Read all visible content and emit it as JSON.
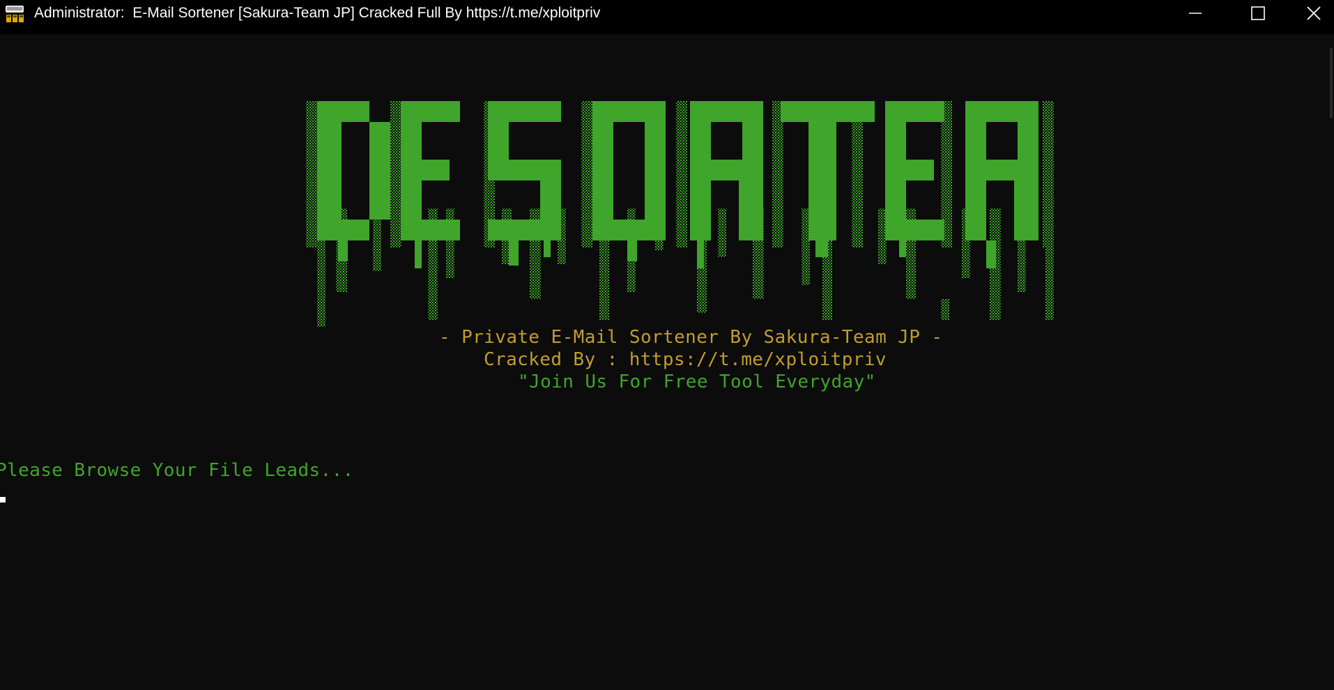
{
  "window": {
    "title": "Administrator:  E-Mail Sortener [Sakura-Team JP] Cracked Full By https://t.me/xploitpriv",
    "icon": "console-app-icon"
  },
  "controls": {
    "minimize_icon": "minimize-icon",
    "maximize_icon": "maximize-icon",
    "close_icon": "close-icon"
  },
  "console": {
    "banner_logo": "DESORTER",
    "lines": [
      "- Private E-Mail Sortener By Sakura-Team JP -",
      "Cracked By : https://t.me/xploitpriv",
      "\"Join Us For Free Tool Everyday\""
    ],
    "prompt": "Please Browse Your File Leads..."
  },
  "colors": {
    "background": "#0c0c0c",
    "titlebar": "#000000",
    "green": "#3fa52b",
    "gold": "#c19c2f",
    "text": "#ffffff"
  }
}
